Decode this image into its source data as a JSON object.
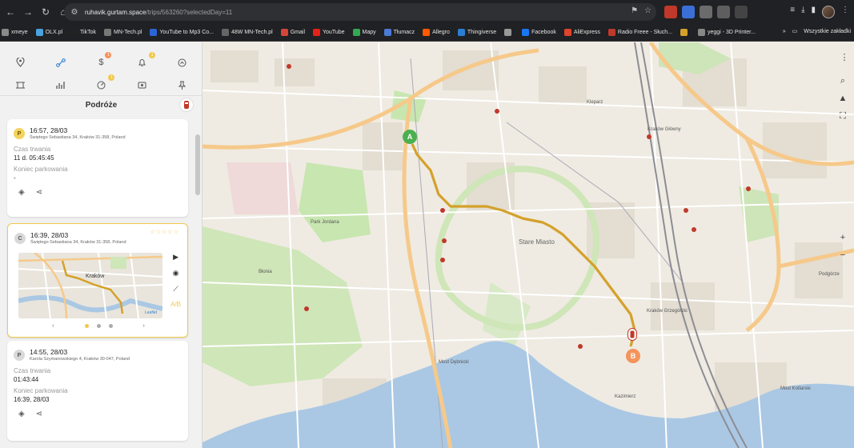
{
  "browser": {
    "url_host": "ruhavik.gurtam.space",
    "url_path": "/trips/563260?selectedDay=11",
    "bookmarks": [
      "xmeye",
      "OLX.pl",
      "TikTok",
      "MN-Tech.pl",
      "YouTube to Mp3 Co...",
      "48W MN-Tech.pl",
      "Gmail",
      "YouTube",
      "Mapy",
      "Tłumacz",
      "Allegro",
      "Thingiverse",
      "",
      "Facebook",
      "AliExpress",
      "Radio Freee - Słuch...",
      "",
      "yeggi - 3D Printer..."
    ],
    "bookmarks_more": "»",
    "all_bookmarks": "Wszystkie zakładki"
  },
  "toolbar": {
    "row1": [
      "location-icon",
      "trips-icon",
      "dollar-icon",
      "bell-icon",
      "timer-icon"
    ],
    "row2": [
      "crop-icon",
      "stats-icon",
      "speedometer-icon",
      "settings-icon",
      "pin-icon"
    ],
    "badges": {
      "dollar": "1",
      "bell": "1",
      "speed": "1"
    }
  },
  "panel": {
    "title": "Podróże"
  },
  "cards": [
    {
      "badge": "P",
      "time": "16:57, 28/03",
      "address": "Świętego Sebastiana 34, Kraków 31-358, Poland",
      "labels": [
        "Czas trwania",
        "Koniec parkowania"
      ],
      "values": [
        "11 d. 05:45:45",
        "-"
      ]
    },
    {
      "badge": "C",
      "time": "16:39, 28/03",
      "address": "Świętego Sebastiana 34, Kraków 31-358, Poland",
      "stars": "☆☆☆☆☆",
      "minimap_label": "Kraków",
      "attribution": "Leaflet",
      "pager_prev": "‹",
      "pager_next": "›"
    },
    {
      "badge": "P",
      "time": "14:55, 28/03",
      "address": "Karola Szymanowskiego 4, Kraków 30-047, Poland",
      "labels": [
        "Czas trwania",
        "Koniec parkowania"
      ],
      "values": [
        "01:43:44",
        "16:39, 28/03"
      ]
    }
  ],
  "map": {
    "start_marker": "A",
    "end_marker": "B",
    "labels": [
      "Stare Miasto",
      "Most Dębnicki",
      "Most Kotlarski",
      "Kraków Główny",
      "Kraków Grzegórzki",
      "Park Jordana",
      "Błonia",
      "Kleparz",
      "Kazimierz",
      "Podgórze"
    ],
    "colors": {
      "route": "#d4a12a",
      "marker": "#f4935c",
      "start": "#4caf50",
      "river": "#aac8e4",
      "park": "#c8e6b0",
      "highway": "#f6c98a"
    }
  }
}
